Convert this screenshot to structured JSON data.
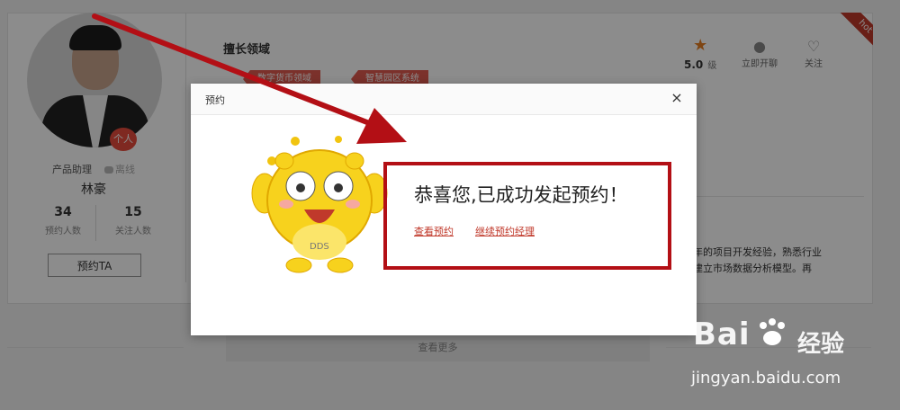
{
  "profile": {
    "role": "产品助理",
    "status": "离线",
    "name": "林豪",
    "badge": "个人",
    "stats": [
      {
        "value": "34",
        "label": "预约人数"
      },
      {
        "value": "15",
        "label": "关注人数"
      }
    ],
    "book_button": "预约TA"
  },
  "expertise": {
    "title": "擅长领域",
    "tags": [
      "数字货币领域",
      "智慧园区系统"
    ]
  },
  "rating": {
    "score": "5.0",
    "unit": "级"
  },
  "actions": {
    "chat": "立即开聊",
    "follow": "关注"
  },
  "ribbon": "hot",
  "description": [
    "年的项目开发经验，熟悉行业",
    "建立市场数据分析模型。再"
  ],
  "see_more": "查看更多",
  "modal": {
    "title": "预约",
    "close": "×",
    "message": "恭喜您,已成功发起预约！",
    "links": [
      "查看预约",
      "继续预约经理"
    ]
  },
  "mascot_text": "DDS",
  "watermark": {
    "logo": "Bai",
    "logo_cn": "经验",
    "url": "jingyan.baidu.com"
  },
  "colors": {
    "accent": "#c0392b",
    "annotation_red": "#b30f15",
    "tag": "#e05a4f",
    "star": "#e67e22"
  }
}
